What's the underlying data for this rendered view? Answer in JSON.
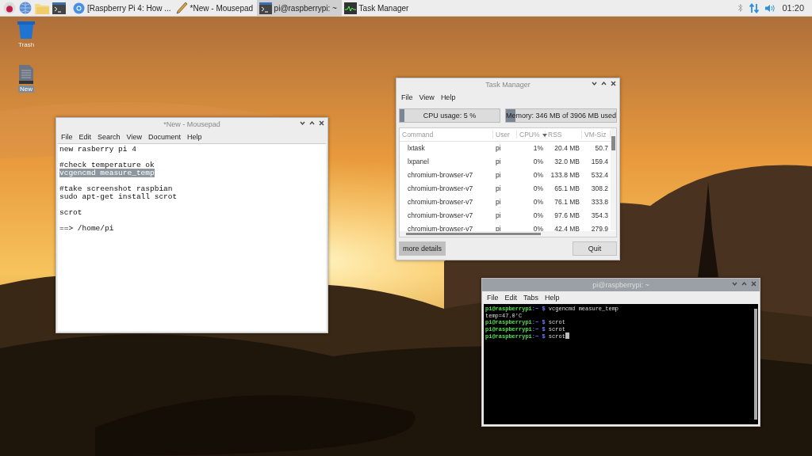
{
  "taskbar": {
    "launchers": [
      {
        "kind": "raspberry"
      },
      {
        "kind": "globe"
      },
      {
        "kind": "folder"
      },
      {
        "kind": "terminal"
      }
    ],
    "tasks": [
      {
        "label": "[Raspberry Pi 4: How ...",
        "kind": "browser",
        "selected": false
      },
      {
        "label": "*New - Mousepad",
        "kind": "editor",
        "selected": false
      },
      {
        "label": "pi@raspberrypi: ~",
        "kind": "terminal",
        "selected": true
      },
      {
        "label": "Task Manager",
        "kind": "monitor",
        "selected": false
      }
    ],
    "clock": "01:20"
  },
  "desktop_icons": [
    {
      "label": "Trash",
      "kind": "trash",
      "selected": false
    },
    {
      "label": "New",
      "kind": "file",
      "selected": true
    }
  ],
  "mousepad": {
    "title": "*New - Mousepad",
    "menu": [
      "File",
      "Edit",
      "Search",
      "View",
      "Document",
      "Help"
    ],
    "paragraphs": [
      {
        "lines": [
          {
            "text": "new rasberry pi 4",
            "selected": false
          }
        ]
      },
      {
        "lines": [
          {
            "text": "#check temperature ok",
            "selected": false
          },
          {
            "text": "vcgencmd measure_temp",
            "selected": true
          }
        ]
      },
      {
        "lines": [
          {
            "text": "#take screenshot raspbian",
            "selected": false
          },
          {
            "text": "sudo apt-get install scrot",
            "selected": false
          }
        ]
      },
      {
        "lines": [
          {
            "text": "scrot",
            "selected": false
          }
        ]
      },
      {
        "lines": [
          {
            "text": "==> /home/pi",
            "selected": false
          }
        ]
      }
    ]
  },
  "task_manager": {
    "title": "Task Manager",
    "menu": [
      "File",
      "View",
      "Help"
    ],
    "cpu": {
      "label": "CPU usage: 5 %",
      "level": 0.05
    },
    "memory": {
      "label": "Memory: 346 MB of 3906 MB used",
      "level": 0.09
    },
    "columns": [
      {
        "label": "Command",
        "sorted": false
      },
      {
        "label": "User",
        "sorted": false
      },
      {
        "label": "CPU%",
        "sorted": true
      },
      {
        "label": "RSS",
        "sorted": false
      },
      {
        "label": "VM-Siz",
        "sorted": false
      }
    ],
    "rows": [
      [
        "lxtask",
        "pi",
        "1%",
        "20.4 MB",
        "50.7"
      ],
      [
        "lxpanel",
        "pi",
        "0%",
        "32.0 MB",
        "159.4"
      ],
      [
        "chromium-browser-v7",
        "pi",
        "0%",
        "133.8 MB",
        "532.4"
      ],
      [
        "chromium-browser-v7",
        "pi",
        "0%",
        "65.1 MB",
        "308.2"
      ],
      [
        "chromium-browser-v7",
        "pi",
        "0%",
        "76.1 MB",
        "333.8"
      ],
      [
        "chromium-browser-v7",
        "pi",
        "0%",
        "97.6 MB",
        "354.3"
      ],
      [
        "chromium-browser-v7",
        "pi",
        "0%",
        "42.4 MB",
        "279.9"
      ]
    ],
    "buttons": [
      "more details",
      "Quit"
    ]
  },
  "terminal": {
    "title": "pi@raspberrypi: ~",
    "menu": [
      "File",
      "Edit",
      "Tabs",
      "Help"
    ],
    "lines": [
      {
        "kind": "prompt",
        "prompt": "pi@raspberrypi",
        "path": ":~ $",
        "command": "vcgencmd measure_temp",
        "cursor": false
      },
      {
        "kind": "output",
        "text": "temp=47.0'C"
      },
      {
        "kind": "prompt",
        "prompt": "pi@raspberrypi",
        "path": ":~ $",
        "command": "scrot",
        "cursor": false
      },
      {
        "kind": "prompt",
        "prompt": "pi@raspberrypi",
        "path": ":~ $",
        "command": "scrot",
        "cursor": false
      },
      {
        "kind": "prompt",
        "prompt": "pi@raspberrypi",
        "path": ":~ $",
        "command": "scrot",
        "cursor": true
      }
    ]
  }
}
